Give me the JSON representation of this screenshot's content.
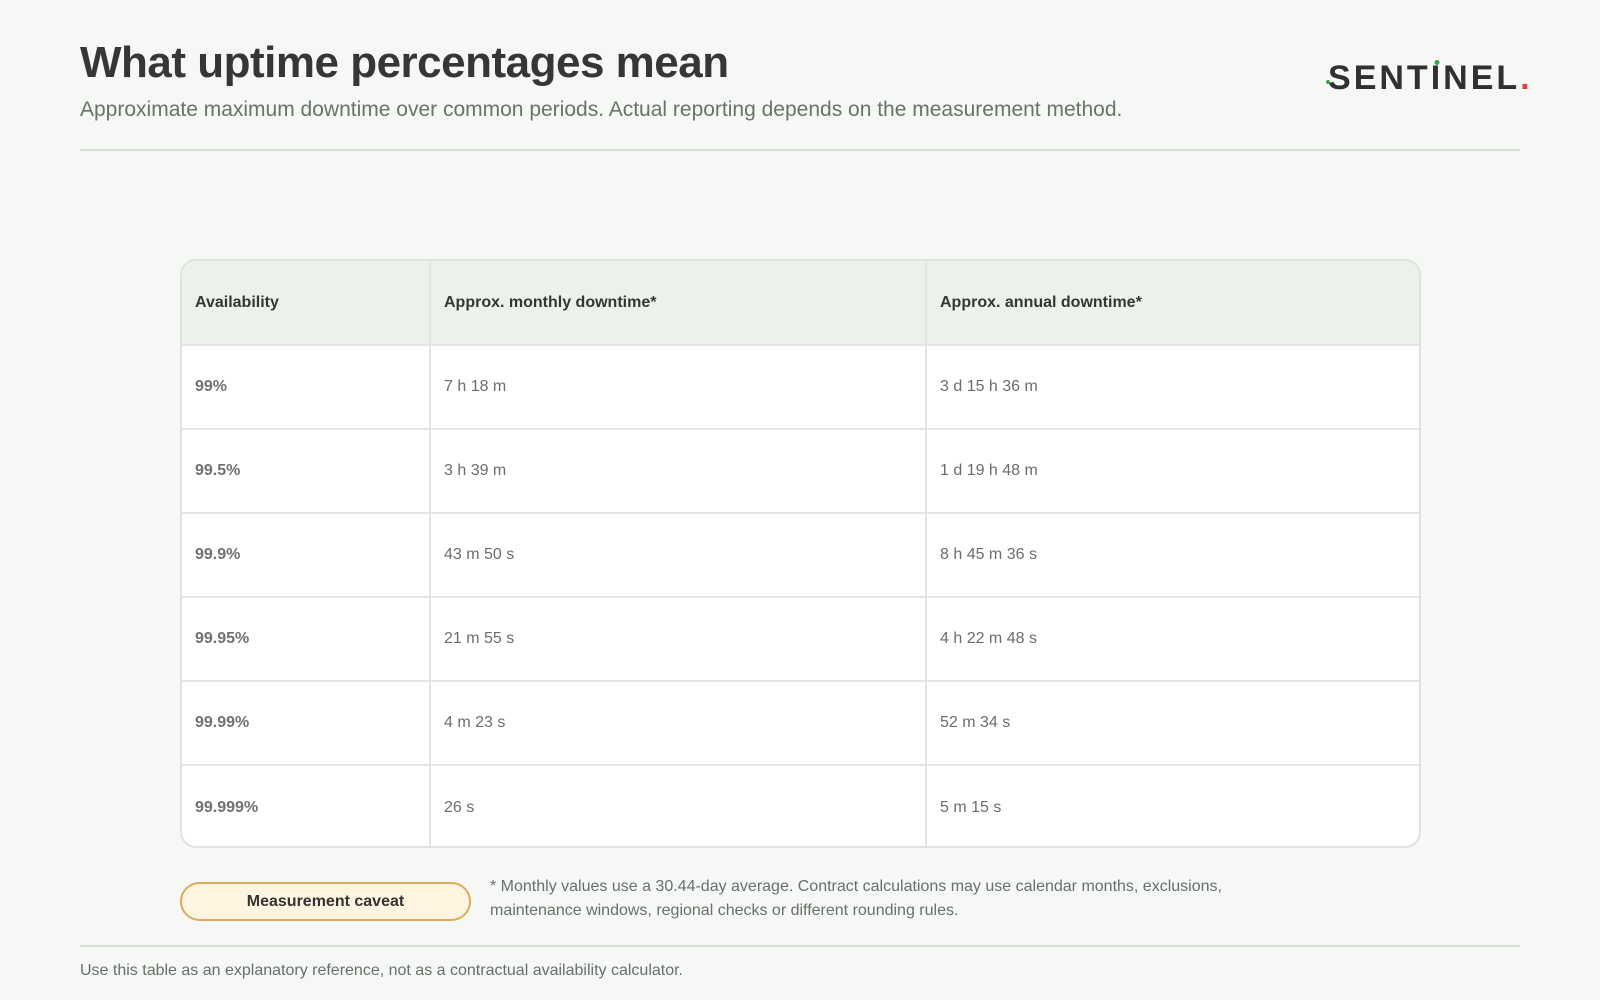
{
  "header": {
    "title": "What uptime percentages mean",
    "subtitle": "Approximate maximum downtime over common periods. Actual reporting depends on the measurement method."
  },
  "logo": {
    "text_main": "SENTINEL",
    "accent_color": "#d9443b",
    "secondary_accent_color": "#3aa44a"
  },
  "table": {
    "columns": [
      "Availability",
      "Approx. monthly downtime*",
      "Approx. annual downtime*"
    ],
    "rows": [
      [
        "99%",
        "7 h 18 m",
        "3 d 15 h 36 m"
      ],
      [
        "99.5%",
        "3 h 39 m",
        "1 d 19 h 48 m"
      ],
      [
        "99.9%",
        "43 m 50 s",
        "8 h 45 m 36 s"
      ],
      [
        "99.95%",
        "21 m 55 s",
        "4 h 22 m 48 s"
      ],
      [
        "99.99%",
        "4 m 23 s",
        "52 m 34 s"
      ],
      [
        "99.999%",
        "26 s",
        "5 m 15 s"
      ]
    ]
  },
  "caveat": {
    "badge_label": "Measurement caveat",
    "text": "* Monthly values use a 30.44-day average. Contract calculations may use calendar months, exclusions, maintenance windows, regional checks or different rounding rules."
  },
  "footer": {
    "note": "Use this table as an explanatory reference, not as a contractual availability calculator."
  }
}
